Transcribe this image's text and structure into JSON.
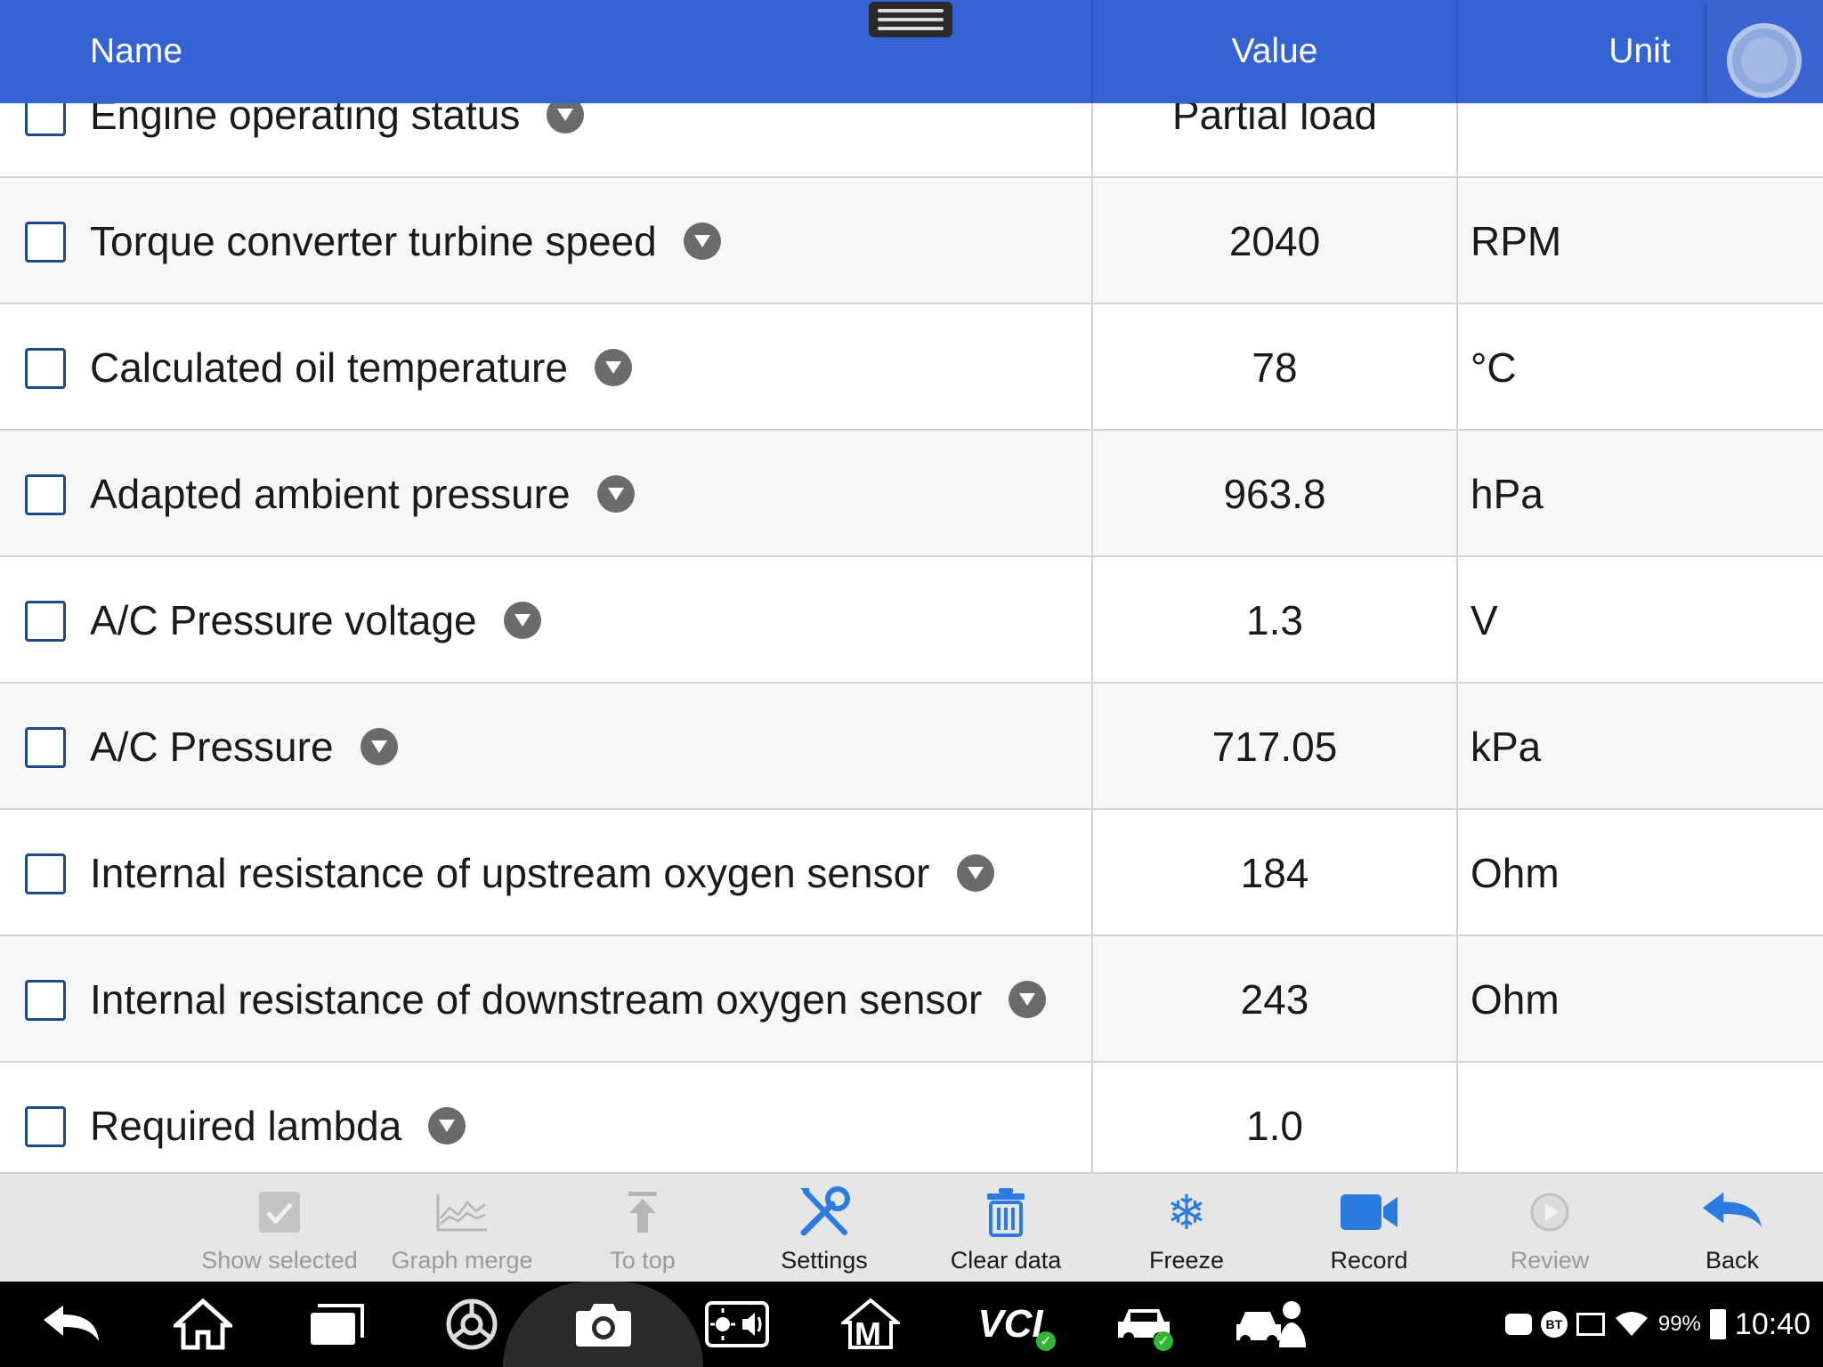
{
  "header": {
    "name_label": "Name",
    "value_label": "Value",
    "unit_label": "Unit"
  },
  "rows": [
    {
      "name": "Engine operating status",
      "value": "Partial load",
      "unit": ""
    },
    {
      "name": "Torque converter turbine speed",
      "value": "2040",
      "unit": "RPM"
    },
    {
      "name": "Calculated oil temperature",
      "value": "78",
      "unit": "°C"
    },
    {
      "name": "Adapted ambient pressure",
      "value": "963.8",
      "unit": "hPa"
    },
    {
      "name": "A/C Pressure voltage",
      "value": "1.3",
      "unit": "V"
    },
    {
      "name": "A/C Pressure",
      "value": "717.05",
      "unit": "kPa"
    },
    {
      "name": "Internal resistance of upstream oxygen sensor",
      "value": "184",
      "unit": "Ohm"
    },
    {
      "name": "Internal resistance of downstream oxygen sensor",
      "value": "243",
      "unit": "Ohm"
    },
    {
      "name": "Required lambda",
      "value": "1.0",
      "unit": ""
    }
  ],
  "toolbar": {
    "show_selected": "Show selected",
    "graph_merge": "Graph merge",
    "to_top": "To top",
    "settings": "Settings",
    "clear_data": "Clear data",
    "freeze": "Freeze",
    "record": "Record",
    "review": "Review",
    "back": "Back"
  },
  "system_bar": {
    "icons": [
      "back-icon",
      "home-icon",
      "recent-apps-icon",
      "browser-icon",
      "camera-icon",
      "brightness-volume-icon",
      "maxifix-icon",
      "vci-icon",
      "car-check-icon",
      "car-service-icon"
    ],
    "vci_label": "VCI",
    "m_label": "M",
    "bt_label": "BT",
    "battery": "99%",
    "clock": "10:40"
  },
  "colors": {
    "header": "#3563d4",
    "accent_blue": "#2b7be0",
    "checkbox_border": "#1f4a8a"
  }
}
